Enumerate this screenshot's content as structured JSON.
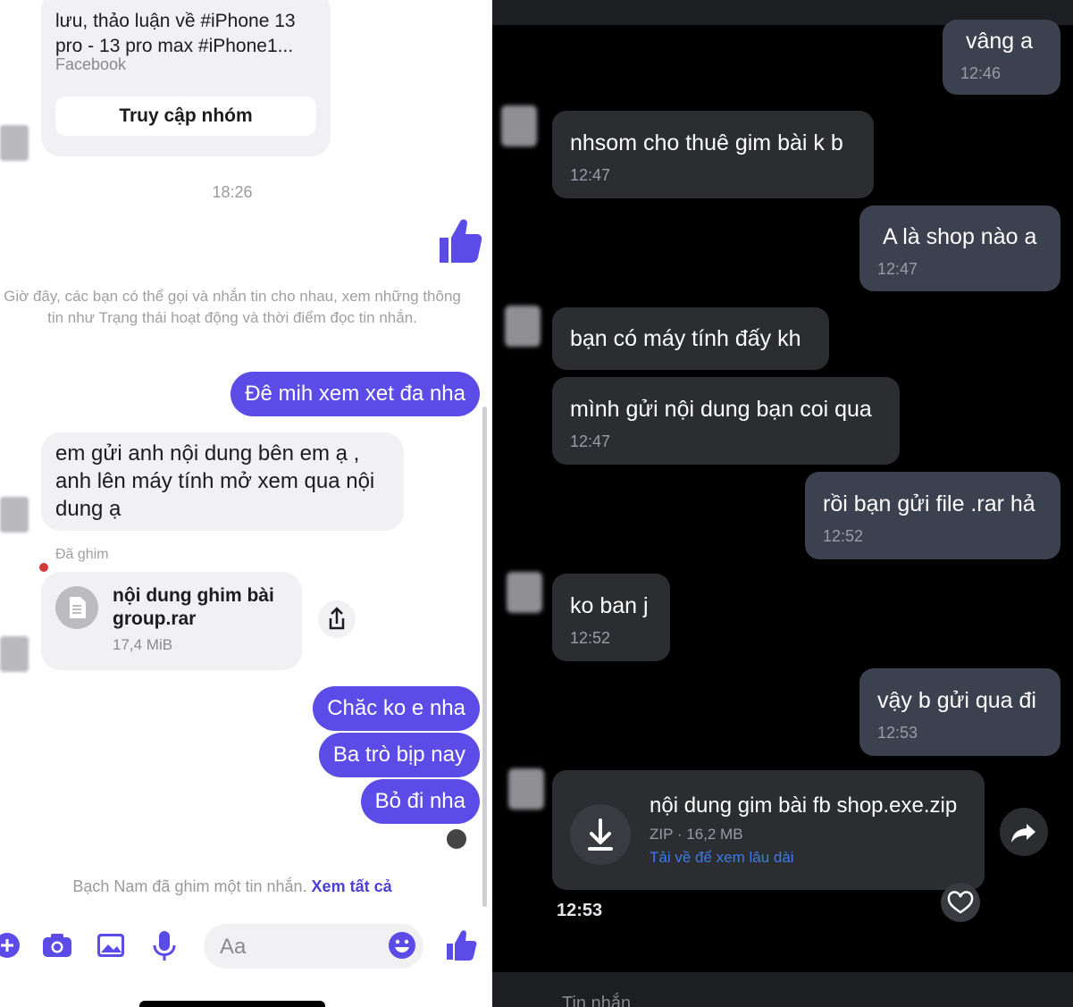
{
  "left": {
    "link_card": {
      "text": "lưu, thảo luận về #iPhone 13 pro - 13 pro max #iPhone1...",
      "source": "Facebook",
      "button": "Truy cập nhóm"
    },
    "timestamp": "18:26",
    "system_note": "Giờ đây, các bạn có thể gọi và nhắn tin cho nhau, xem những thông tin như Trạng thái hoạt động và thời điểm đọc tin nhắn.",
    "messages": {
      "out1": "Đê mih xem xet đa nha",
      "in1": "em gửi anh nội dung bên em ạ , anh lên máy tính mở xem qua nội dung ạ",
      "out2": "Chăc ko e nha",
      "out3": "Ba trò bịp nay",
      "out4": "Bỏ đi nha"
    },
    "pinned": {
      "label": "Đã ghim",
      "file_name": "nội dung ghim bài group.rar",
      "file_size": "17,4 MiB"
    },
    "pin_notice": {
      "text": "Bạch Nam đã ghim một tin nhắn.",
      "link": "Xem tất cả"
    },
    "composer": {
      "placeholder": "Aa"
    },
    "colors": {
      "accent": "#5b4ce8",
      "bubble_in": "#f1f1f3"
    }
  },
  "right": {
    "messages": [
      {
        "dir": "out",
        "text": "vâng a",
        "time": "12:46"
      },
      {
        "dir": "in",
        "text": "nhsom cho thuê gim bài k b",
        "time": "12:47"
      },
      {
        "dir": "out",
        "text": "A là shop nào a",
        "time": "12:47"
      },
      {
        "dir": "in",
        "text": "bạn có máy tính đấy kh",
        "time": ""
      },
      {
        "dir": "in",
        "text": "mình gửi nội dung bạn coi qua",
        "time": "12:47"
      },
      {
        "dir": "out",
        "text": "rồi bạn gửi file .rar hả",
        "time": "12:52"
      },
      {
        "dir": "in",
        "text": "ko ban j",
        "time": "12:52"
      },
      {
        "dir": "out",
        "text": "vậy b gửi qua đi",
        "time": "12:53"
      }
    ],
    "file": {
      "name": "nội dung gim bài fb shop.exe.zip",
      "meta": "ZIP · 16,2 MB",
      "hint": "Tải về để xem lâu dài",
      "time": "12:53"
    },
    "composer_placeholder": "Tin nhắn",
    "colors": {
      "bubble_out": "#3c4150",
      "bubble_in": "#2c2d31",
      "link": "#3d7be8"
    }
  }
}
